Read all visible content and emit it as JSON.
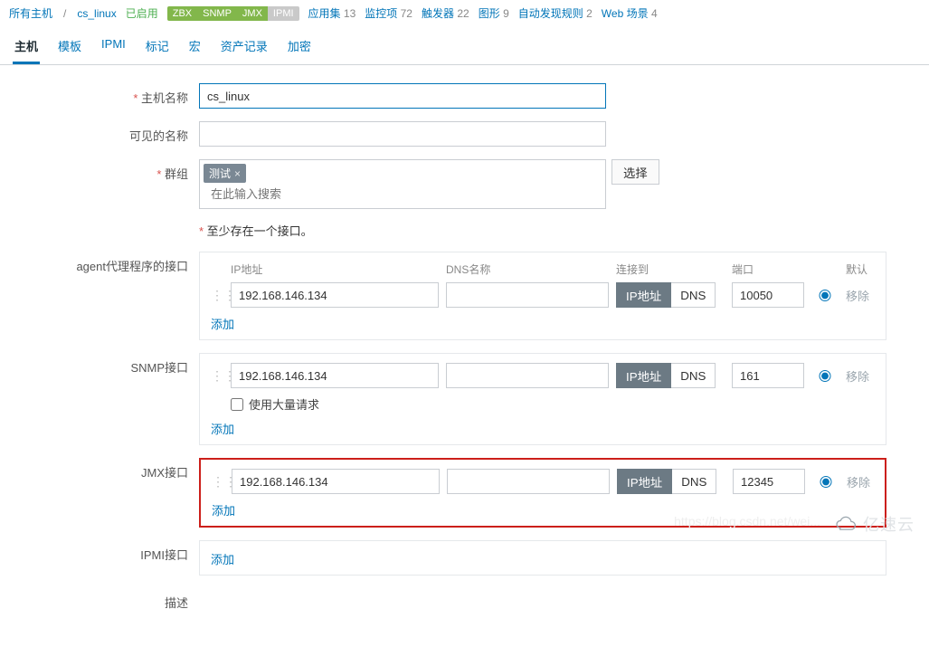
{
  "breadcrumb": {
    "all_hosts": "所有主机",
    "current": "cs_linux"
  },
  "status": {
    "enabled": "已启用"
  },
  "badges": {
    "zbx": "ZBX",
    "snmp": "SNMP",
    "jmx": "JMX",
    "ipmi": "IPMI"
  },
  "stats": {
    "apps": {
      "label": "应用集",
      "count": "13"
    },
    "items": {
      "label": "监控项",
      "count": "72"
    },
    "triggers": {
      "label": "触发器",
      "count": "22"
    },
    "graphs": {
      "label": "图形",
      "count": "9"
    },
    "discovery": {
      "label": "自动发现规则",
      "count": "2"
    },
    "web": {
      "label": "Web 场景",
      "count": "4"
    }
  },
  "tabs": [
    "主机",
    "模板",
    "IPMI",
    "标记",
    "宏",
    "资产记录",
    "加密"
  ],
  "labels": {
    "host_name": "主机名称",
    "visible_name": "可见的名称",
    "groups": "群组",
    "select_btn": "选择",
    "group_tag": "测试",
    "group_search_placeholder": "在此输入搜索",
    "iface_hint": "至少存在一个接口。",
    "agent_iface": "agent代理程序的接口",
    "snmp_iface": "SNMP接口",
    "jmx_iface": "JMX接口",
    "ipmi_iface": "IPMI接口",
    "col_ip": "IP地址",
    "col_dns": "DNS名称",
    "col_connect": "连接到",
    "col_port": "端口",
    "col_default": "默认",
    "seg_ip": "IP地址",
    "seg_dns": "DNS",
    "remove": "移除",
    "add": "添加",
    "bulk_request": "使用大量请求",
    "desc": "描述"
  },
  "form": {
    "host_name": "cs_linux",
    "visible_name": "",
    "agent": {
      "ip": "192.168.146.134",
      "dns": "",
      "port": "10050"
    },
    "snmp": {
      "ip": "192.168.146.134",
      "dns": "",
      "port": "161",
      "bulk": false
    },
    "jmx": {
      "ip": "192.168.146.134",
      "dns": "",
      "port": "12345"
    }
  },
  "watermark": {
    "text": "亿速云",
    "url": "https://blog.csdn.net/wei..."
  }
}
